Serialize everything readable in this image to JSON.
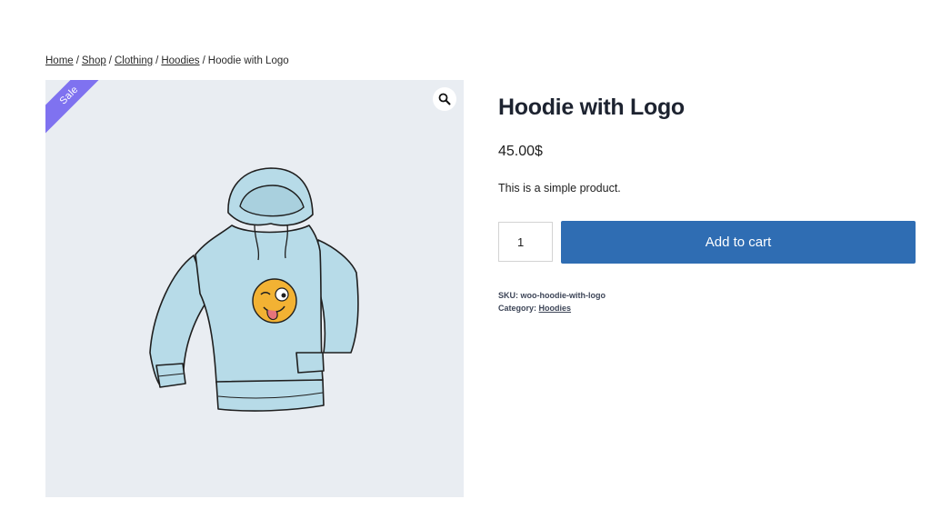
{
  "breadcrumb": {
    "items": [
      "Home",
      "Shop",
      "Clothing",
      "Hoodies"
    ],
    "current": "Hoodie with Logo",
    "separator": "/"
  },
  "gallery": {
    "badge": "Sale",
    "zoom_icon": "search-icon",
    "image": "hoodie-with-logo-illustration"
  },
  "product": {
    "title": "Hoodie with Logo",
    "price": "45.00$",
    "short_description": "This is a simple product.",
    "quantity": "1",
    "add_to_cart_label": "Add to cart",
    "sku_label": "SKU:",
    "sku": "woo-hoodie-with-logo",
    "category_label": "Category:",
    "category": "Hoodies"
  },
  "colors": {
    "sale_badge": "#7f72f0",
    "button": "#2f6db3",
    "gallery_bg": "#e9edf2"
  }
}
